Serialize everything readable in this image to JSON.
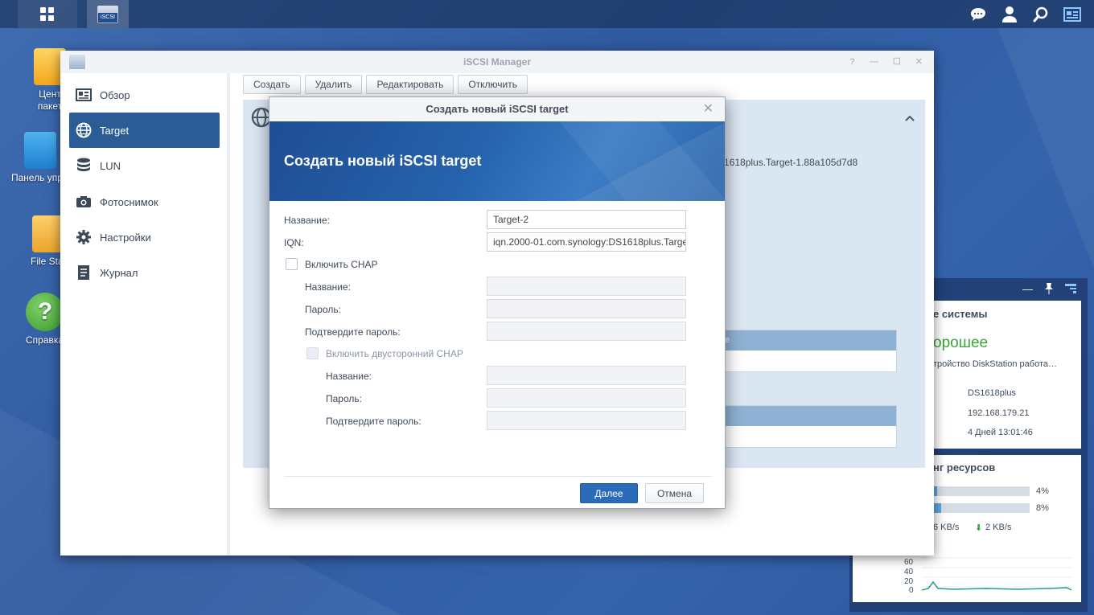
{
  "taskbar": {
    "main_menu_icon": "grid-icon",
    "app_icon": "iscsi-icon",
    "app_icon_label": "iSCSI",
    "right_icons": [
      "chat-icon",
      "user-icon",
      "search-icon",
      "widgets-icon"
    ]
  },
  "desktop": {
    "icons": [
      {
        "label": "Цент\nпакет",
        "icon": "package-center-icon",
        "color": "#f5b92e"
      },
      {
        "label": "Панель упр",
        "icon": "control-panel-icon",
        "color": "#2a8fd8"
      },
      {
        "label": "File Sta",
        "icon": "folder-icon",
        "color": "#f3b73a"
      },
      {
        "label": "Справка",
        "icon": "help-icon",
        "color": "#4fae3e"
      }
    ]
  },
  "window": {
    "title": "iSCSI Manager",
    "controls": [
      "?",
      "—",
      "☐",
      "✕"
    ],
    "sidebar": [
      {
        "label": "Обзор",
        "icon": "overview-icon"
      },
      {
        "label": "Target",
        "icon": "globe-icon"
      },
      {
        "label": "LUN",
        "icon": "database-icon"
      },
      {
        "label": "Фотоснимок",
        "icon": "camera-icon"
      },
      {
        "label": "Настройки",
        "icon": "gear-icon"
      },
      {
        "label": "Журнал",
        "icon": "log-icon"
      }
    ],
    "toolbar": [
      "Создать",
      "Удалить",
      "Редактировать",
      "Отключить"
    ],
    "target_iqn_fragment": "1618plus.Target-1.88a105d7d8",
    "table1_header_fragment": "e"
  },
  "dialog": {
    "title": "Создать новый iSCSI target",
    "banner": "Создать новый iSCSI target",
    "name_label": "Название:",
    "name_value": "Target-2",
    "iqn_label": "IQN:",
    "iqn_value": "iqn.2000-01.com.synology:DS1618plus.Target-2",
    "chap_label": "Включить CHAP",
    "chap_name_label": "Название:",
    "chap_pass_label": "Пароль:",
    "chap_confirm_label": "Подтвердите пароль:",
    "mutual_label": "Включить двусторонний CHAP",
    "mutual_name_label": "Название:",
    "mutual_pass_label": "Пароль:",
    "mutual_confirm_label": "Подтвердите пароль:",
    "next_button": "Далее",
    "cancel_button": "Отмена"
  },
  "widget": {
    "header_icons": [
      "minimize-icon",
      "pin-icon",
      "widgets-icon"
    ],
    "health_title": "е системы",
    "health_status": "орошее",
    "health_status_color": "#3aa33a",
    "health_desc": "тройство DiskStation работа…",
    "server_name": "DS1618plus",
    "ip": "192.168.179.21",
    "uptime": "4 Дней 13:01:46",
    "resource_title": "нг ресурсов",
    "cpu_percent": "4%",
    "cpu_value": 0.04,
    "ram_percent": "8%",
    "ram_value": 0.08,
    "upload": "6 KB/s",
    "download": "2 KB/s",
    "chart_ticks": [
      "60",
      "40",
      "20",
      "0"
    ]
  }
}
